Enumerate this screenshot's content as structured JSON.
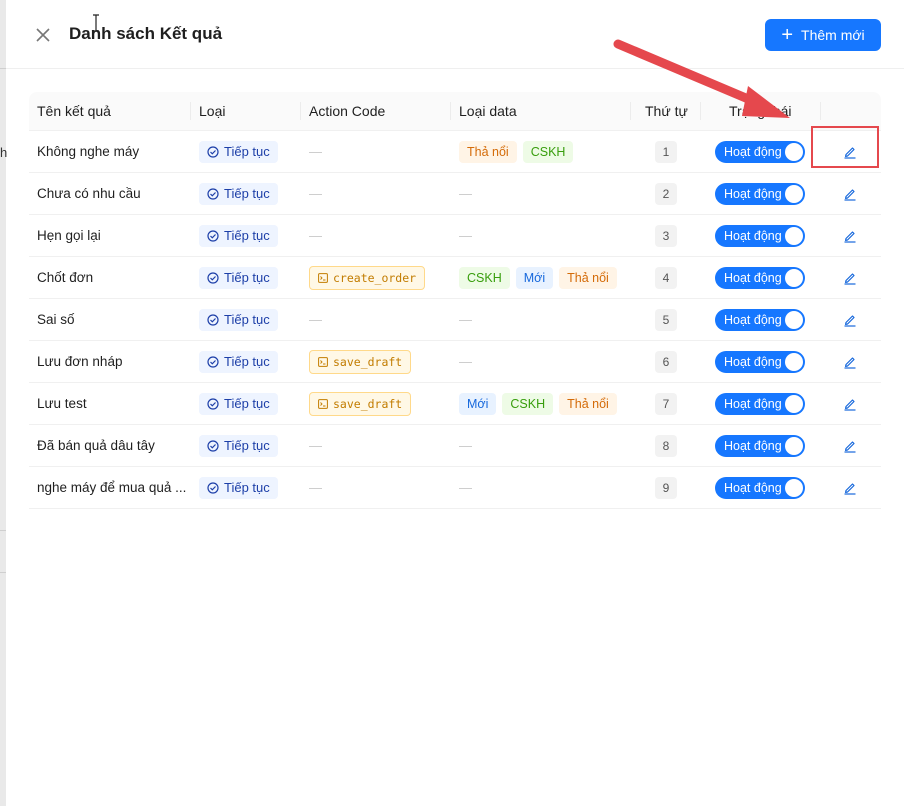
{
  "backdrop": {
    "fragment": "h"
  },
  "header": {
    "title": "Danh sách Kết quả",
    "add_button_label": "Thêm mới",
    "add_button_icon": "plus-icon",
    "close_icon": "close-icon"
  },
  "table": {
    "columns": [
      "Tên kết quả",
      "Loại",
      "Action Code",
      "Loại data",
      "Thứ tự",
      "Trạng thái",
      ""
    ],
    "rows": [
      {
        "name": "Không nghe máy",
        "type": "Tiếp tục",
        "action": "",
        "data": [
          {
            "label": "Thả nổi",
            "color": "orange"
          },
          {
            "label": "CSKH",
            "color": "green"
          }
        ],
        "order": "1",
        "status": "Hoạt động"
      },
      {
        "name": "Chưa có nhu cầu",
        "type": "Tiếp tục",
        "action": "",
        "data": [],
        "order": "2",
        "status": "Hoạt động"
      },
      {
        "name": "Hẹn gọi lại",
        "type": "Tiếp tục",
        "action": "",
        "data": [],
        "order": "3",
        "status": "Hoạt động"
      },
      {
        "name": "Chốt đơn",
        "type": "Tiếp tục",
        "action": "create_order",
        "data": [
          {
            "label": "CSKH",
            "color": "green"
          },
          {
            "label": "Mới",
            "color": "blue"
          },
          {
            "label": "Thả nổi",
            "color": "orange"
          }
        ],
        "order": "4",
        "status": "Hoạt động"
      },
      {
        "name": "Sai số",
        "type": "Tiếp tục",
        "action": "",
        "data": [],
        "order": "5",
        "status": "Hoạt động"
      },
      {
        "name": "Lưu đơn nháp",
        "type": "Tiếp tục",
        "action": "save_draft",
        "data": [],
        "order": "6",
        "status": "Hoạt động"
      },
      {
        "name": "Lưu test",
        "type": "Tiếp tục",
        "action": "save_draft",
        "data": [
          {
            "label": "Mới",
            "color": "blue"
          },
          {
            "label": "CSKH",
            "color": "green"
          },
          {
            "label": "Thả nổi",
            "color": "orange"
          }
        ],
        "order": "7",
        "status": "Hoạt động"
      },
      {
        "name": "Đã bán quả dâu tây",
        "type": "Tiếp tục",
        "action": "",
        "data": [],
        "order": "8",
        "status": "Hoạt động"
      },
      {
        "name": "nghe máy để mua quả ...",
        "type": "Tiếp tục",
        "action": "",
        "data": [],
        "order": "9",
        "status": "Hoạt động"
      }
    ],
    "empty_placeholder": "—"
  },
  "colors": {
    "primary": "#1677ff",
    "annotation": "#e5484d"
  }
}
